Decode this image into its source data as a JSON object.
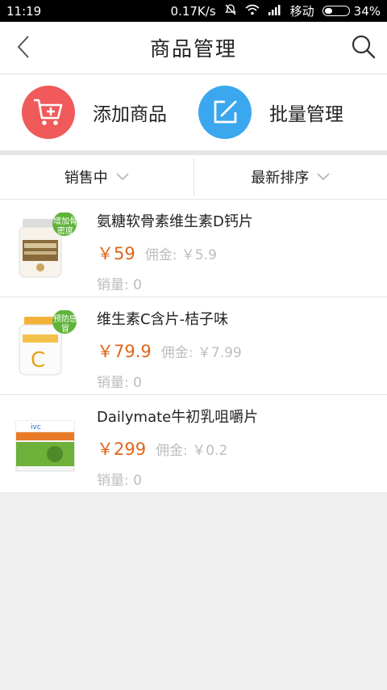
{
  "status_bar": {
    "time": "11:19",
    "speed": "0.17K/s",
    "carrier": "移动",
    "battery": "34%",
    "battery_level": 0.34
  },
  "header": {
    "title": "商品管理",
    "back_icon": "chevron-left-icon",
    "search_icon": "search-icon"
  },
  "actions": [
    {
      "label": "添加商品",
      "icon": "cart-plus-icon",
      "color": "#f05a5a"
    },
    {
      "label": "批量管理",
      "icon": "edit-icon",
      "color": "#3aa7ee"
    }
  ],
  "filters": [
    {
      "label": "销售中"
    },
    {
      "label": "最新排序"
    }
  ],
  "products": [
    {
      "name": "氨糖软骨素维生素D钙片",
      "price": "￥59",
      "commission": "佣金: ￥5.9",
      "sales": "销量: 0",
      "badge": "增加骨密度"
    },
    {
      "name": "维生素C含片-桔子味",
      "price": "￥79.9",
      "commission": "佣金: ￥7.99",
      "sales": "销量: 0",
      "badge": "预防感冒"
    },
    {
      "name": "Dailymate牛初乳咀嚼片",
      "price": "￥299",
      "commission": "佣金: ￥0.2",
      "sales": "销量: 0",
      "badge": ""
    }
  ],
  "colors": {
    "price": "#e0661a",
    "muted": "#bdbdbd",
    "add_button": "#f05a5a",
    "batch_button": "#3aa7ee"
  }
}
